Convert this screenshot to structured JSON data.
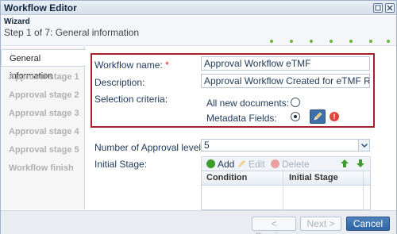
{
  "window": {
    "title": "Workflow Editor"
  },
  "wizard": {
    "label": "Wizard",
    "step": "Step 1 of 7: General information"
  },
  "sidebar": {
    "items": [
      {
        "label": "General information"
      },
      {
        "label": "Approval stage 1"
      },
      {
        "label": "Approval stage 2"
      },
      {
        "label": "Approval stage 3"
      },
      {
        "label": "Approval stage 4"
      },
      {
        "label": "Approval stage 5"
      },
      {
        "label": "Workflow finish"
      }
    ]
  },
  "form": {
    "workflow_name_label": "Workflow name:",
    "required_mark": "*",
    "workflow_name_value": "Approval Workflow eTMF",
    "description_label": "Description:",
    "description_value": "Approval Workflow Created for eTMF Room",
    "selection_criteria_label": "Selection criteria:",
    "option_all_new": "All new documents:",
    "option_metadata": "Metadata Fields:",
    "approval_levels_label": "Number of Approval levels:",
    "approval_levels_value": "5",
    "initial_stage_label": "Initial Stage:"
  },
  "grid": {
    "add": "Add",
    "edit": "Edit",
    "delete": "Delete",
    "columns": [
      "Condition",
      "Initial Stage"
    ]
  },
  "footer": {
    "previous": "< Previous",
    "next": "Next >",
    "cancel": "Cancel"
  },
  "colors": {
    "accent": "#2f64a2",
    "highlight_border": "#a8202a",
    "add_green": "#3c9a2e",
    "delete_red": "#e06464"
  }
}
